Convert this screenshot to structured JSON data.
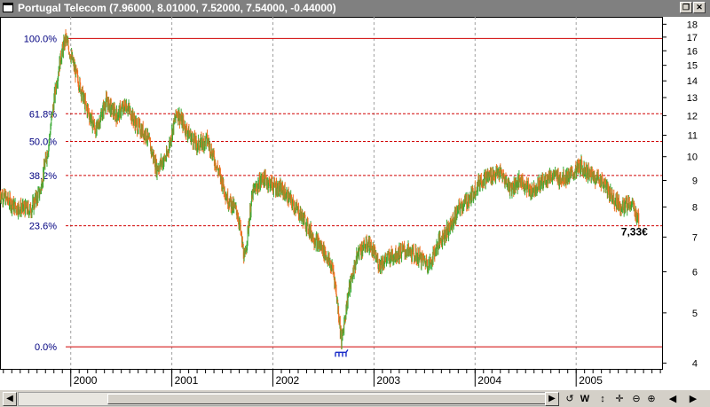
{
  "window": {
    "title": "Portugal Telecom (7.96000, 8.01000, 7.52000, 7.54000, -0.44000)",
    "restore_icon": "restore-icon",
    "close_icon": "close-icon"
  },
  "toolbar": {
    "refresh_label": "↺",
    "week_label": "W",
    "move_label": "↕",
    "pan_label": "✛",
    "zoom_out_label": "⊖",
    "zoom_in_label": "⊕",
    "scroll_left_label": "◀",
    "scroll_right_label": "▶",
    "nav_left_label": "◀",
    "nav_right_label": "▶"
  },
  "chart_data": {
    "type": "candlestick",
    "title": "Portugal Telecom",
    "price_label": "7,33€",
    "y_scale": "log",
    "ylim": [
      3.9,
      18.6
    ],
    "y_ticks": [
      4,
      5,
      6,
      7,
      8,
      9,
      10,
      11,
      12,
      13,
      14,
      15,
      16,
      17,
      18
    ],
    "x_labels": [
      {
        "label": "2000",
        "t": 2000.0
      },
      {
        "label": "2001",
        "t": 2001.0
      },
      {
        "label": "2002",
        "t": 2002.0
      },
      {
        "label": "2003",
        "t": 2003.0
      },
      {
        "label": "2004",
        "t": 2004.0
      },
      {
        "label": "2005",
        "t": 2005.0
      }
    ],
    "xlim": [
      1999.3,
      2005.85
    ],
    "fib_levels": [
      {
        "label": "100.0%",
        "price": 16.9,
        "style": "solid"
      },
      {
        "label": "61.8%",
        "price": 12.1,
        "style": "dashed"
      },
      {
        "label": "50.0%",
        "price": 10.7,
        "style": "dashed"
      },
      {
        "label": "38.2%",
        "price": 9.2,
        "style": "dashed"
      },
      {
        "label": "23.6%",
        "price": 7.36,
        "style": "dashed"
      },
      {
        "label": "0.0%",
        "price": 4.3,
        "style": "solid"
      }
    ],
    "price_path": [
      [
        1999.3,
        8.5
      ],
      [
        1999.45,
        8.0
      ],
      [
        1999.6,
        7.9
      ],
      [
        1999.7,
        8.6
      ],
      [
        1999.78,
        10.5
      ],
      [
        1999.85,
        13.5
      ],
      [
        1999.9,
        15.5
      ],
      [
        1999.95,
        16.9
      ],
      [
        2000.05,
        14.5
      ],
      [
        2000.15,
        12.5
      ],
      [
        2000.25,
        11.2
      ],
      [
        2000.35,
        12.8
      ],
      [
        2000.45,
        12.0
      ],
      [
        2000.55,
        12.6
      ],
      [
        2000.65,
        11.5
      ],
      [
        2000.75,
        11.0
      ],
      [
        2000.85,
        9.5
      ],
      [
        2000.95,
        10.0
      ],
      [
        2001.05,
        12.2
      ],
      [
        2001.15,
        11.2
      ],
      [
        2001.25,
        10.5
      ],
      [
        2001.35,
        10.8
      ],
      [
        2001.45,
        9.5
      ],
      [
        2001.55,
        8.3
      ],
      [
        2001.65,
        7.8
      ],
      [
        2001.72,
        6.3
      ],
      [
        2001.8,
        8.5
      ],
      [
        2001.9,
        9.1
      ],
      [
        2002.0,
        8.8
      ],
      [
        2002.1,
        8.6
      ],
      [
        2002.2,
        8.1
      ],
      [
        2002.3,
        7.6
      ],
      [
        2002.4,
        7.0
      ],
      [
        2002.5,
        6.6
      ],
      [
        2002.6,
        6.0
      ],
      [
        2002.68,
        4.4
      ],
      [
        2002.75,
        5.5
      ],
      [
        2002.85,
        6.6
      ],
      [
        2002.95,
        6.8
      ],
      [
        2003.05,
        6.2
      ],
      [
        2003.15,
        6.4
      ],
      [
        2003.3,
        6.6
      ],
      [
        2003.45,
        6.4
      ],
      [
        2003.55,
        6.2
      ],
      [
        2003.65,
        6.9
      ],
      [
        2003.75,
        7.3
      ],
      [
        2003.85,
        8.0
      ],
      [
        2003.95,
        8.3
      ],
      [
        2004.05,
        9.0
      ],
      [
        2004.15,
        9.2
      ],
      [
        2004.25,
        9.3
      ],
      [
        2004.35,
        8.7
      ],
      [
        2004.45,
        9.0
      ],
      [
        2004.55,
        8.6
      ],
      [
        2004.65,
        8.9
      ],
      [
        2004.75,
        9.2
      ],
      [
        2004.85,
        9.1
      ],
      [
        2004.95,
        9.2
      ],
      [
        2005.05,
        9.6
      ],
      [
        2005.15,
        9.2
      ],
      [
        2005.25,
        9.0
      ],
      [
        2005.35,
        8.4
      ],
      [
        2005.45,
        8.0
      ],
      [
        2005.55,
        8.1
      ],
      [
        2005.62,
        7.54
      ]
    ],
    "colors": {
      "up": "#3aaa35",
      "down": "#f07020",
      "fib": "#d00000",
      "fib_label": "#000080",
      "grid": "#a0a0a0"
    }
  }
}
